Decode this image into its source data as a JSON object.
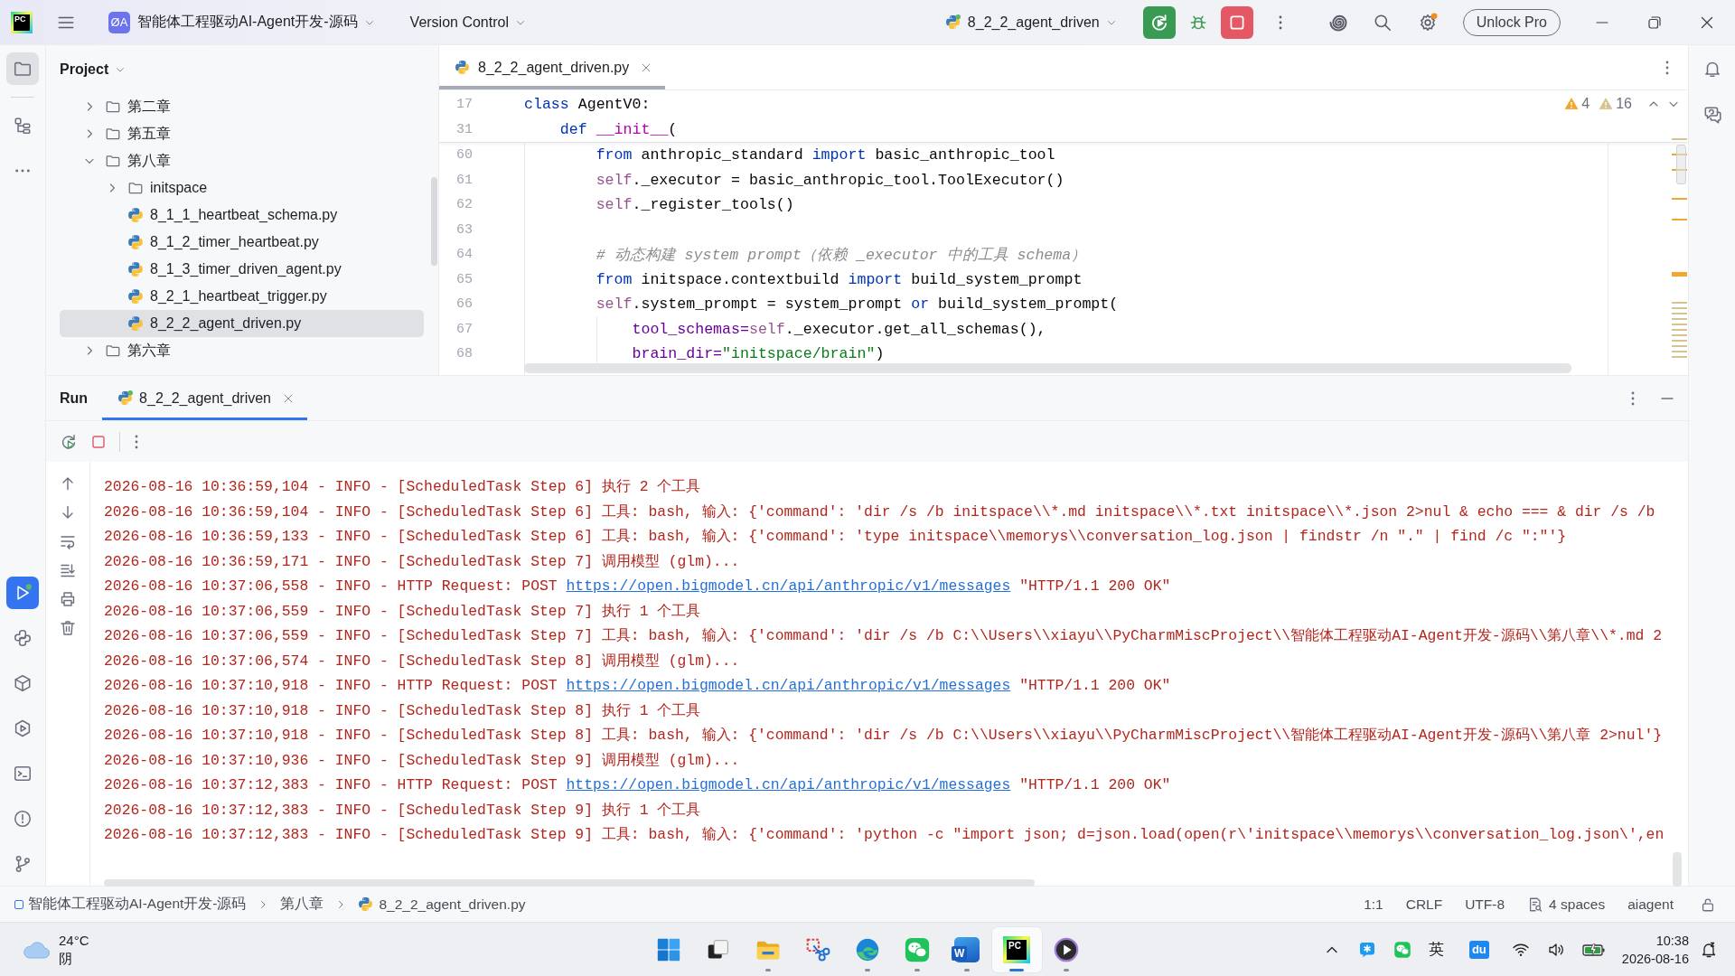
{
  "title_bar": {
    "logo_text": "PC",
    "project_badge": "ØA",
    "project_name": "智能体工程驱动AI-Agent开发-源码",
    "vcs_menu": "Version Control",
    "run_config": "8_2_2_agent_driven",
    "unlock_button": "Unlock Pro"
  },
  "left_toolbar": {
    "top": [
      {
        "kind": "project",
        "selected": true,
        "focused": false
      },
      {
        "kind": "structure",
        "selected": false,
        "focused": false
      },
      {
        "kind": "more",
        "selected": false,
        "focused": false
      }
    ],
    "bottom": [
      {
        "kind": "run",
        "selected": true,
        "focused": true
      },
      {
        "kind": "python_console",
        "selected": false,
        "focused": false
      },
      {
        "kind": "python_packages",
        "selected": false,
        "focused": false
      },
      {
        "kind": "services",
        "selected": false,
        "focused": false
      },
      {
        "kind": "terminal",
        "selected": false,
        "focused": false
      },
      {
        "kind": "problems",
        "selected": false,
        "focused": false
      },
      {
        "kind": "git",
        "selected": false,
        "focused": false
      }
    ]
  },
  "project": {
    "title": "Project",
    "tree": [
      {
        "label": "第二章",
        "kind": "folder",
        "expanded": false,
        "selected": false
      },
      {
        "label": "第五章",
        "kind": "folder",
        "expanded": false,
        "selected": false
      },
      {
        "label": "第八章",
        "kind": "folder",
        "expanded": true,
        "selected": false,
        "children": [
          {
            "label": "initspace",
            "kind": "folder",
            "expanded": false,
            "selected": false
          },
          {
            "label": "8_1_1_heartbeat_schema.py",
            "kind": "file",
            "selected": false
          },
          {
            "label": "8_1_2_timer_heartbeat.py",
            "kind": "file",
            "selected": false
          },
          {
            "label": "8_1_3_timer_driven_agent.py",
            "kind": "file",
            "selected": false
          },
          {
            "label": "8_2_1_heartbeat_trigger.py",
            "kind": "file",
            "selected": false
          },
          {
            "label": "8_2_2_agent_driven.py",
            "kind": "file",
            "selected": true
          }
        ]
      },
      {
        "label": "第六章",
        "kind": "folder",
        "expanded": false,
        "selected": false
      }
    ]
  },
  "editor": {
    "tabs": [
      {
        "label": "8_2_2_agent_driven.py",
        "selected": true
      }
    ],
    "warnings": "4",
    "weak_warnings": "16",
    "sticky_lines": [
      {
        "number": "17",
        "tokens": [
          {
            "kind": "kw",
            "text": "class "
          },
          {
            "kind": "plain",
            "text": "AgentV0:"
          }
        ]
      },
      {
        "number": "31",
        "tokens": [
          {
            "kind": "kw",
            "text": "    def "
          },
          {
            "kind": "dunder",
            "text": "__init__"
          },
          {
            "kind": "plain",
            "text": "("
          }
        ]
      }
    ],
    "lines": [
      {
        "number": "60",
        "tokens": [
          {
            "kind": "kw",
            "text": "        from "
          },
          {
            "kind": "plain",
            "text": "anthropic_standard "
          },
          {
            "kind": "kw",
            "text": "import "
          },
          {
            "kind": "plain",
            "text": "basic_anthropic_tool"
          }
        ]
      },
      {
        "number": "61",
        "tokens": [
          {
            "kind": "self",
            "text": "        self"
          },
          {
            "kind": "plain",
            "text": "._executor = basic_anthropic_tool.ToolExecutor()"
          }
        ]
      },
      {
        "number": "62",
        "tokens": [
          {
            "kind": "self",
            "text": "        self"
          },
          {
            "kind": "plain",
            "text": "._register_tools()"
          }
        ]
      },
      {
        "number": "63"
      },
      {
        "number": "64",
        "tokens": [
          {
            "kind": "comment",
            "text": "        # 动态构建 system prompt（依赖 _executor 中的工具 schema）"
          }
        ]
      },
      {
        "number": "65",
        "tokens": [
          {
            "kind": "kw",
            "text": "        from "
          },
          {
            "kind": "plain",
            "text": "initspace.contextbuild "
          },
          {
            "kind": "kw",
            "text": "import "
          },
          {
            "kind": "plain",
            "text": "build_system_prompt"
          }
        ]
      },
      {
        "number": "66",
        "tokens": [
          {
            "kind": "self",
            "text": "        self"
          },
          {
            "kind": "plain",
            "text": ".system_prompt = system_prompt "
          },
          {
            "kind": "kw",
            "text": "or "
          },
          {
            "kind": "plain",
            "text": "build_system_prompt("
          }
        ]
      },
      {
        "number": "67",
        "tokens": [
          {
            "kind": "param",
            "text": "            tool_schemas="
          },
          {
            "kind": "self",
            "text": "self"
          },
          {
            "kind": "plain",
            "text": "._executor.get_all_schemas(),"
          }
        ]
      },
      {
        "number": "68",
        "tokens": [
          {
            "kind": "param",
            "text": "            brain_dir="
          },
          {
            "kind": "string",
            "text": "\"initspace/brain\""
          },
          {
            "kind": "plain",
            "text": ")"
          }
        ]
      }
    ]
  },
  "run": {
    "title": "Run",
    "tabs": [
      {
        "label": "8_2_2_agent_driven",
        "selected": true
      }
    ],
    "log": [
      {
        "text": "2026-08-16 10:36:59,104 - INFO - [ScheduledTask Step 6] 执行 2 个工具"
      },
      {
        "text": "2026-08-16 10:36:59,104 - INFO - [ScheduledTask Step 6] 工具: bash, 输入: {'command': 'dir /s /b initspace\\\\*.md initspace\\\\*.txt initspace\\\\*.json 2>nul & echo === & dir /s /b"
      },
      {
        "text": "2026-08-16 10:36:59,133 - INFO - [ScheduledTask Step 6] 工具: bash, 输入: {'command': 'type initspace\\\\memorys\\\\conversation_log.json | findstr /n \".\" | find /c \":\"'}"
      },
      {
        "text": "2026-08-16 10:36:59,171 - INFO - [ScheduledTask Step 7] 调用模型 (glm)..."
      },
      {
        "text": "2026-08-16 10:37:06,558 - INFO - HTTP Request: POST ",
        "link": "https://open.bigmodel.cn/api/anthropic/v1/messages",
        "tail": " \"HTTP/1.1 200 OK\""
      },
      {
        "text": "2026-08-16 10:37:06,559 - INFO - [ScheduledTask Step 7] 执行 1 个工具"
      },
      {
        "text": "2026-08-16 10:37:06,559 - INFO - [ScheduledTask Step 7] 工具: bash, 输入: {'command': 'dir /s /b C:\\\\Users\\\\xiayu\\\\PyCharmMiscProject\\\\智能体工程驱动AI-Agent开发-源码\\\\第八章\\\\*.md 2"
      },
      {
        "text": "2026-08-16 10:37:06,574 - INFO - [ScheduledTask Step 8] 调用模型 (glm)..."
      },
      {
        "text": "2026-08-16 10:37:10,918 - INFO - HTTP Request: POST ",
        "link": "https://open.bigmodel.cn/api/anthropic/v1/messages",
        "tail": " \"HTTP/1.1 200 OK\""
      },
      {
        "text": "2026-08-16 10:37:10,918 - INFO - [ScheduledTask Step 8] 执行 1 个工具"
      },
      {
        "text": "2026-08-16 10:37:10,918 - INFO - [ScheduledTask Step 8] 工具: bash, 输入: {'command': 'dir /s /b C:\\\\Users\\\\xiayu\\\\PyCharmMiscProject\\\\智能体工程驱动AI-Agent开发-源码\\\\第八章 2>nul'}"
      },
      {
        "text": "2026-08-16 10:37:10,936 - INFO - [ScheduledTask Step 9] 调用模型 (glm)..."
      },
      {
        "text": "2026-08-16 10:37:12,383 - INFO - HTTP Request: POST ",
        "link": "https://open.bigmodel.cn/api/anthropic/v1/messages",
        "tail": " \"HTTP/1.1 200 OK\""
      },
      {
        "text": "2026-08-16 10:37:12,383 - INFO - [ScheduledTask Step 9] 执行 1 个工具"
      },
      {
        "text": "2026-08-16 10:37:12,383 - INFO - [ScheduledTask Step 9] 工具: bash, 输入: {'command': 'python -c \"import json; d=json.load(open(r\\'initspace\\\\memorys\\\\conversation_log.json\\',en"
      }
    ]
  },
  "status_bar": {
    "breadcrumbs": [
      {
        "label": "智能体工程驱动AI-Agent开发-源码",
        "kind": "project"
      },
      {
        "label": "第八章",
        "kind": "folder"
      },
      {
        "label": "8_2_2_agent_driven.py",
        "kind": "python"
      }
    ],
    "position": "1:1",
    "line_separator": "CRLF",
    "encoding": "UTF-8",
    "indent": "4 spaces",
    "interpreter": "aiagent"
  },
  "taskbar": {
    "weather": {
      "temperature": "24°C",
      "condition": "阴"
    },
    "apps": [
      {
        "kind": "start",
        "running": false,
        "selected": false
      },
      {
        "kind": "task_view",
        "running": false,
        "selected": false
      },
      {
        "kind": "explorer",
        "running": true,
        "selected": false
      },
      {
        "kind": "snipping",
        "running": false,
        "selected": false
      },
      {
        "kind": "edge",
        "running": true,
        "selected": false
      },
      {
        "kind": "wechat",
        "running": true,
        "selected": false
      },
      {
        "kind": "word",
        "label": "W",
        "running": true,
        "selected": false
      },
      {
        "kind": "pycharm",
        "label": "PC",
        "running": true,
        "selected": true
      },
      {
        "kind": "media_player",
        "running": true,
        "selected": false
      }
    ],
    "tray": {
      "ime": "英",
      "app_badge": "du"
    },
    "clock": {
      "time": "10:38",
      "date": "2026-08-16"
    }
  }
}
